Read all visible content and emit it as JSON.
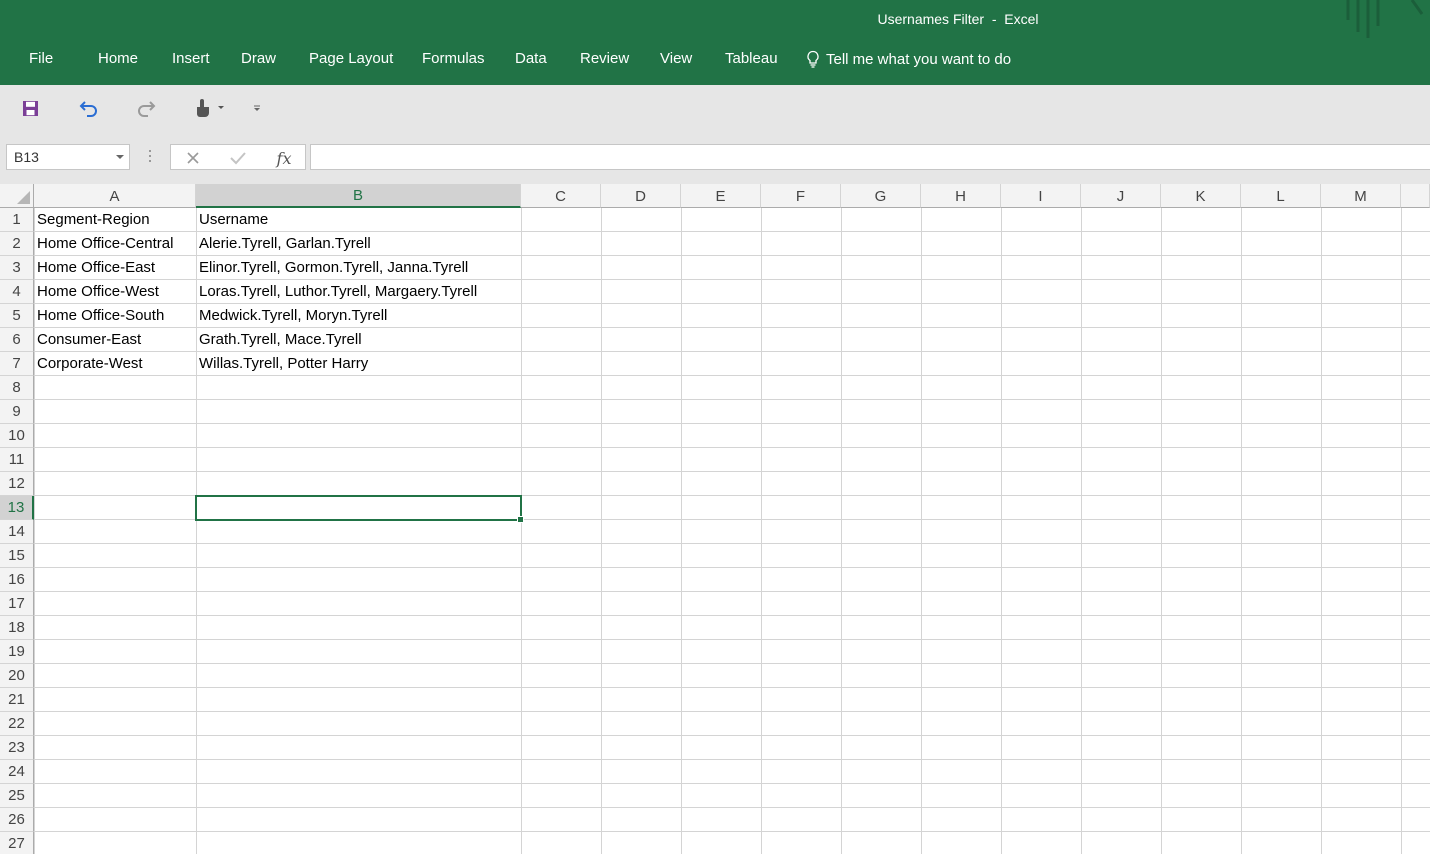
{
  "window": {
    "title": "Usernames Filter  -  Excel"
  },
  "colors": {
    "brand": "#217346",
    "ribbon_bg": "#e6e6e6",
    "gridline": "#d4d4d4"
  },
  "menu": {
    "file": "File",
    "home": "Home",
    "insert": "Insert",
    "draw": "Draw",
    "page_layout": "Page Layout",
    "formulas": "Formulas",
    "data": "Data",
    "review": "Review",
    "view": "View",
    "tableau": "Tableau",
    "tell_me": "Tell me what you want to do"
  },
  "quick_access": {
    "icons": [
      "save-icon",
      "undo-icon",
      "redo-icon",
      "touch-mode-icon",
      "customize-qat-icon"
    ]
  },
  "formula_bar": {
    "name_box": "B13",
    "formula": "",
    "fx_label": "fx"
  },
  "sheet": {
    "columns": [
      "A",
      "B",
      "C",
      "D",
      "E",
      "F",
      "G",
      "H",
      "I",
      "J",
      "K",
      "L",
      "M"
    ],
    "selected_column": "B",
    "selected_row": 13,
    "rows": [
      [
        "Segment-Region",
        "Username"
      ],
      [
        "Home Office-Central",
        "Alerie.Tyrell,  Garlan.Tyrell"
      ],
      [
        "Home Office-East",
        "Elinor.Tyrell, Gormon.Tyrell, Janna.Tyrell"
      ],
      [
        "Home Office-West",
        "Loras.Tyrell, Luthor.Tyrell, Margaery.Tyrell"
      ],
      [
        "Home Office-South",
        "Medwick.Tyrell, Moryn.Tyrell"
      ],
      [
        "Consumer-East",
        "Grath.Tyrell, Mace.Tyrell"
      ],
      [
        "Corporate-West",
        "Willas.Tyrell, Potter Harry"
      ]
    ],
    "row_numbers": [
      "1",
      "2",
      "3",
      "4",
      "5",
      "6",
      "7",
      "8",
      "9",
      "10",
      "11",
      "12",
      "13",
      "14",
      "15",
      "16",
      "17",
      "18",
      "19",
      "20",
      "21",
      "22",
      "23",
      "24",
      "25",
      "26",
      "27"
    ]
  }
}
